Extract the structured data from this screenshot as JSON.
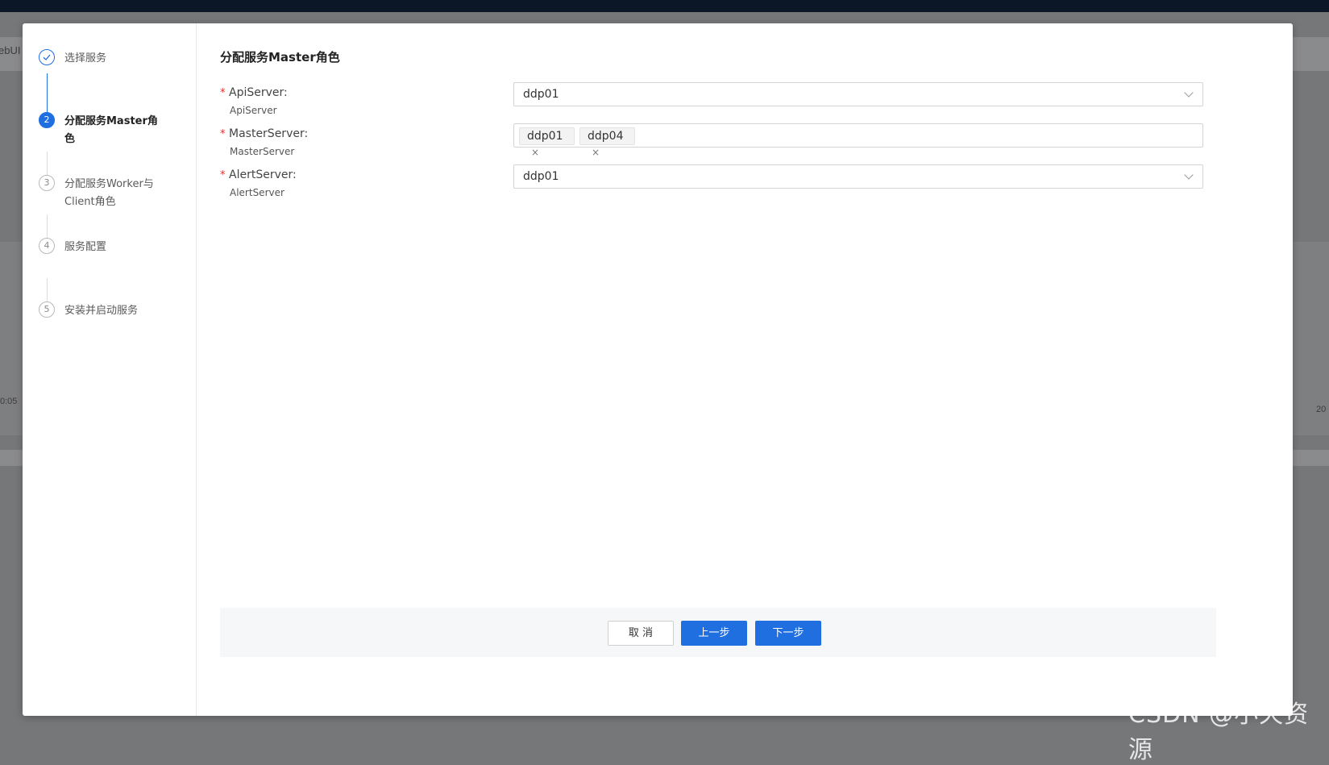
{
  "background": {
    "left_text": "ebUI",
    "axis_left": "0:05",
    "axis_right": "20"
  },
  "steps": [
    {
      "number": "1",
      "label": "选择服务",
      "state": "done"
    },
    {
      "number": "2",
      "label": "分配服务Master角色",
      "state": "active"
    },
    {
      "number": "3",
      "label": "分配服务Worker与Client角色",
      "state": "pending"
    },
    {
      "number": "4",
      "label": "服务配置",
      "state": "pending"
    },
    {
      "number": "5",
      "label": "安装并启动服务",
      "state": "pending"
    }
  ],
  "page_title": "分配服务Master角色",
  "form": {
    "required_mark": "*",
    "api_server": {
      "label": "ApiServer:",
      "sublabel": "ApiServer",
      "value": "ddp01"
    },
    "master_server": {
      "label": "MasterServer:",
      "sublabel": "MasterServer",
      "tags": [
        "ddp01",
        "ddp04"
      ],
      "tag_close": "×"
    },
    "alert_server": {
      "label": "AlertServer:",
      "sublabel": "AlertServer",
      "value": "ddp01"
    }
  },
  "footer": {
    "cancel": "取 消",
    "prev": "上一步",
    "next": "下一步"
  },
  "watermark": "CSDN @小天资源",
  "colors": {
    "primary": "#1f6fe0",
    "required": "#e0302f"
  }
}
